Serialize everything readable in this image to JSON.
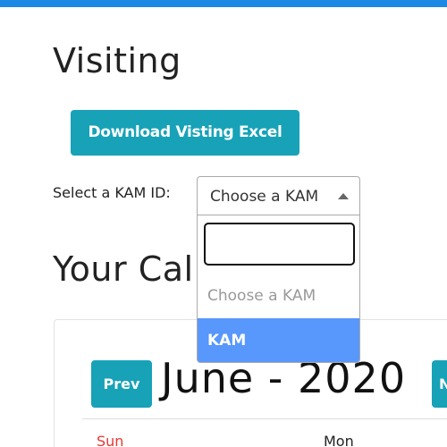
{
  "page": {
    "title": "Visiting",
    "accent_color": "#17a2b8",
    "top_bar_color": "#1e88e5"
  },
  "download": {
    "label": "Download Visting Excel"
  },
  "kam_select": {
    "label": "Select a KAM ID:",
    "selected": "Choose a KAM",
    "arrow_icon": "caret-up-icon",
    "search_value": "",
    "options": [
      {
        "label": "Choose a KAM",
        "state": "placeholder"
      },
      {
        "label": "KAM",
        "state": "highlighted"
      }
    ],
    "highlight_color": "#5897fb"
  },
  "calendar": {
    "heading": "Your Cal",
    "prev_label": "Prev",
    "next_label": "N",
    "month_label": "June - 2020",
    "weekdays": [
      "Sun",
      "Mon"
    ],
    "sunday_color": "#e53935"
  }
}
